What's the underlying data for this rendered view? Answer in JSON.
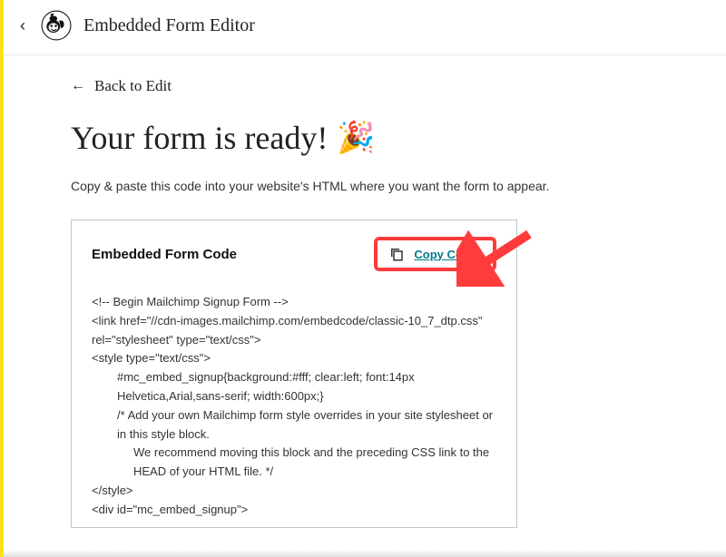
{
  "header": {
    "title": "Embedded Form Editor"
  },
  "content": {
    "back_label": "Back to Edit",
    "heading": "Your form is ready!",
    "subtext": "Copy & paste this code into your website's HTML where you want the form to appear."
  },
  "code_panel": {
    "label": "Embedded Form Code",
    "copy_button": "Copy Code",
    "lines": {
      "l1": "<!-- Begin Mailchimp Signup Form -->",
      "l2": "<link href=\"//cdn-images.mailchimp.com/embedcode/classic-10_7_dtp.css\" rel=\"stylesheet\" type=\"text/css\">",
      "l3": "<style type=\"text/css\">",
      "l4": "#mc_embed_signup{background:#fff; clear:left; font:14px Helvetica,Arial,sans-serif;  width:600px;}",
      "l5": "/* Add your own Mailchimp form style overrides in your site stylesheet or in this style block.",
      "l6": "We recommend moving this block and the preceding CSS link to the HEAD of your HTML file. */",
      "l7": "</style>",
      "l8": "<div id=\"mc_embed_signup\">"
    }
  },
  "icons": {
    "back_chevron": "‹",
    "back_arrow": "←"
  }
}
